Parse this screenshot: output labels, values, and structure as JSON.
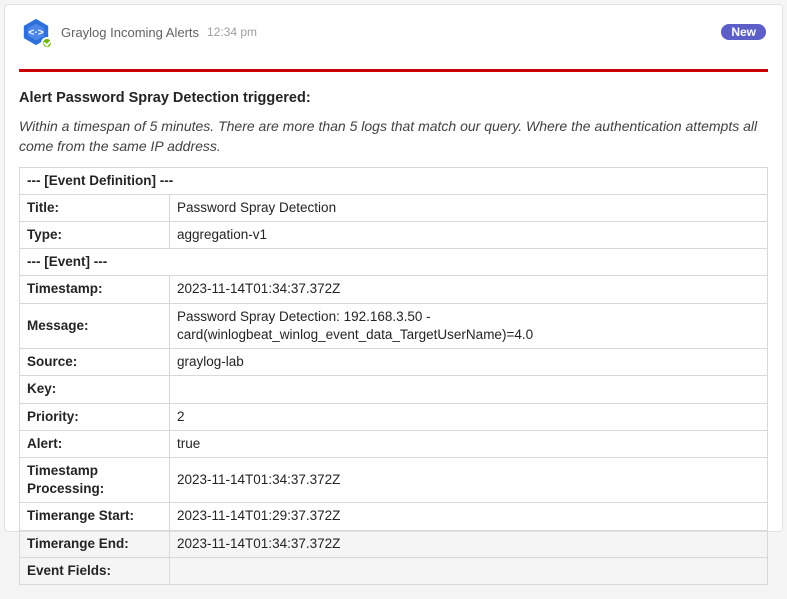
{
  "header": {
    "sender": "Graylog Incoming Alerts",
    "time": "12:34 pm",
    "badge": "New"
  },
  "alert": {
    "title": "Alert Password Spray Detection triggered:",
    "description": "Within a timespan of 5 minutes. There are more than 5 logs that match our query. Where the authentication attempts all come from the same IP address."
  },
  "sections": {
    "eventDefinition": "--- [Event Definition] ---",
    "event": "--- [Event] ---"
  },
  "fields": {
    "titleLabel": "Title:",
    "titleValue": "Password Spray Detection",
    "typeLabel": "Type:",
    "typeValue": "aggregation-v1",
    "timestampLabel": "Timestamp:",
    "timestampValue": "2023-11-14T01:34:37.372Z",
    "messageLabel": "Message:",
    "messageValue": "Password Spray Detection: 192.168.3.50 - card(winlogbeat_winlog_event_data_TargetUserName)=4.0",
    "sourceLabel": "Source:",
    "sourceValue": "graylog-lab",
    "keyLabel": "Key:",
    "keyValue": "",
    "priorityLabel": "Priority:",
    "priorityValue": "2",
    "alertLabel": "Alert:",
    "alertValue": "true",
    "tsProcLabel": "Timestamp Processing:",
    "tsProcValue": "2023-11-14T01:34:37.372Z",
    "trStartLabel": "Timerange Start:",
    "trStartValue": "2023-11-14T01:29:37.372Z",
    "trEndLabel": "Timerange End:",
    "trEndValue": "2023-11-14T01:34:37.372Z",
    "eventFieldsLabel": "Event Fields:",
    "eventFieldsValue": ""
  }
}
